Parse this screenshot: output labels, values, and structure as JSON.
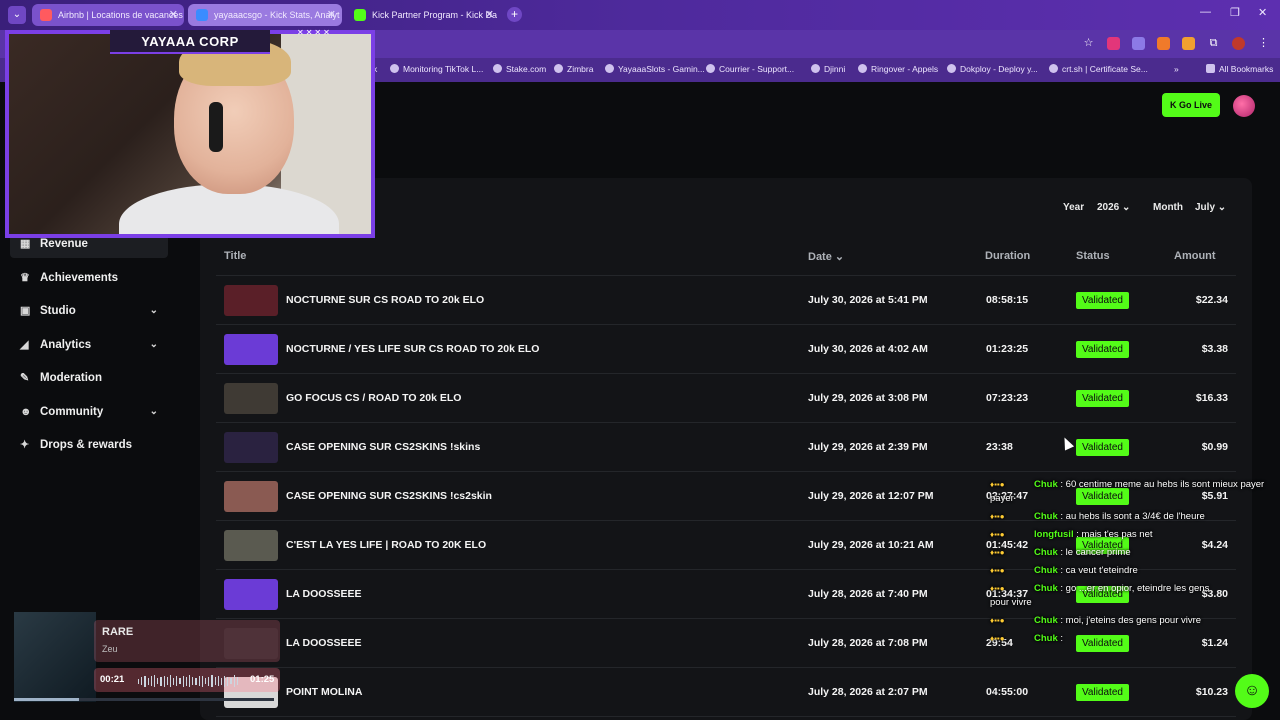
{
  "browser": {
    "tabs": [
      {
        "label": "Airbnb | Locations de vacances",
        "favicon_color": "#ff5a5f"
      },
      {
        "label": "yayaaacsgo - Kick Stats, Analyt",
        "favicon_color": "#3a8cff"
      },
      {
        "label": "Kick Partner Program - Kick Da",
        "favicon_color": "#53fc18"
      }
    ],
    "bookmarks": [
      "k",
      "Monitoring TikTok L...",
      "Stake.com",
      "Zimbra",
      "YayaaaSlots - Gamin...",
      "Courrier - Support...",
      "Djinni",
      "Ringover - Appels",
      "Dokploy - Deploy y...",
      "crt.sh | Certificate Se...",
      "All Bookmarks"
    ]
  },
  "header": {
    "go_live": "Go Live"
  },
  "webcam": {
    "banner": "YAYAAA CORP"
  },
  "sidebar": {
    "items": [
      {
        "label": "Revenue",
        "icon": "chart-icon",
        "active": true,
        "expandable": false
      },
      {
        "label": "Achievements",
        "icon": "trophy-icon",
        "active": false,
        "expandable": false
      },
      {
        "label": "Studio",
        "icon": "studio-icon",
        "active": false,
        "expandable": true
      },
      {
        "label": "Analytics",
        "icon": "analytics-icon",
        "active": false,
        "expandable": true
      },
      {
        "label": "Moderation",
        "icon": "wrench-icon",
        "active": false,
        "expandable": false
      },
      {
        "label": "Community",
        "icon": "community-icon",
        "active": false,
        "expandable": true
      },
      {
        "label": "Drops & rewards",
        "icon": "gift-icon",
        "active": false,
        "expandable": false
      }
    ]
  },
  "filters": {
    "year_label": "Year",
    "year_value": "2026",
    "month_label": "Month",
    "month_value": "July"
  },
  "table": {
    "columns": [
      "Title",
      "Date",
      "Duration",
      "Status",
      "Amount"
    ],
    "rows": [
      {
        "title": "NOCTURNE SUR CS ROAD TO 20k ELO",
        "date": "July 30, 2026 at 5:41 PM",
        "duration": "08:58:15",
        "status": "Validated",
        "amount": "$22.34",
        "thumb": "#5a1f28"
      },
      {
        "title": "NOCTURNE / YES LIFE SUR CS ROAD TO 20k ELO",
        "date": "July 30, 2026 at 4:02 AM",
        "duration": "01:23:25",
        "status": "Validated",
        "amount": "$3.38",
        "thumb": "#6b3bd6"
      },
      {
        "title": "GO FOCUS CS / ROAD TO 20k ELO",
        "date": "July 29, 2026 at 3:08 PM",
        "duration": "07:23:23",
        "status": "Validated",
        "amount": "$16.33",
        "thumb": "#3f3a34"
      },
      {
        "title": "CASE OPENING SUR CS2SKINS !skins",
        "date": "July 29, 2026 at 2:39 PM",
        "duration": "23:38",
        "status": "Validated",
        "amount": "$0.99",
        "thumb": "#2a2240"
      },
      {
        "title": "CASE OPENING SUR CS2SKINS !cs2skin",
        "date": "July 29, 2026 at 12:07 PM",
        "duration": "02:27:47",
        "status": "Validated",
        "amount": "$5.91",
        "thumb": "#8a5a52"
      },
      {
        "title": "C'EST LA YES LIFE | ROAD TO 20K ELO",
        "date": "July 29, 2026 at 10:21 AM",
        "duration": "01:45:42",
        "status": "Validated",
        "amount": "$4.24",
        "thumb": "#5a5a50"
      },
      {
        "title": "LA DOOSSEEE",
        "date": "July 28, 2026 at 7:40 PM",
        "duration": "01:34:37",
        "status": "Validated",
        "amount": "$3.80",
        "thumb": "#6b3bd6"
      },
      {
        "title": "LA DOOSSEEE",
        "date": "July 28, 2026 at 7:08 PM",
        "duration": "29:54",
        "status": "Validated",
        "amount": "$1.24",
        "thumb": "#1e1f22"
      },
      {
        "title": "POINT MOLINA",
        "date": "July 28, 2026 at 2:07 PM",
        "duration": "04:55:00",
        "status": "Validated",
        "amount": "$10.23",
        "thumb": "#d8d8d8"
      }
    ]
  },
  "chat": [
    {
      "user": "Chuk",
      "text": "60 centime meme au hebs ils sont mieux payer"
    },
    {
      "user": "",
      "text": "payer"
    },
    {
      "user": "Chuk",
      "text": "au hebs ils sont a 3/4€ de l'heure"
    },
    {
      "user": "longfusil",
      "text": "mais t'es pas net"
    },
    {
      "user": "Chuk",
      "text": "le cancer prime"
    },
    {
      "user": "Chuk",
      "text": "ca veut t'eteindre"
    },
    {
      "user": "Chuk",
      "text": "go ...er en opior, eteindre les gens"
    },
    {
      "user": "",
      "text": "pour vivre"
    },
    {
      "user": "Chuk",
      "text": "moi, j'eteins des gens pour vivre"
    },
    {
      "user": "Chuk",
      "text": ""
    }
  ],
  "music": {
    "title": "RARE",
    "artist": "Zeu",
    "elapsed": "00:21",
    "total": "01:25",
    "progress": 0.25
  }
}
